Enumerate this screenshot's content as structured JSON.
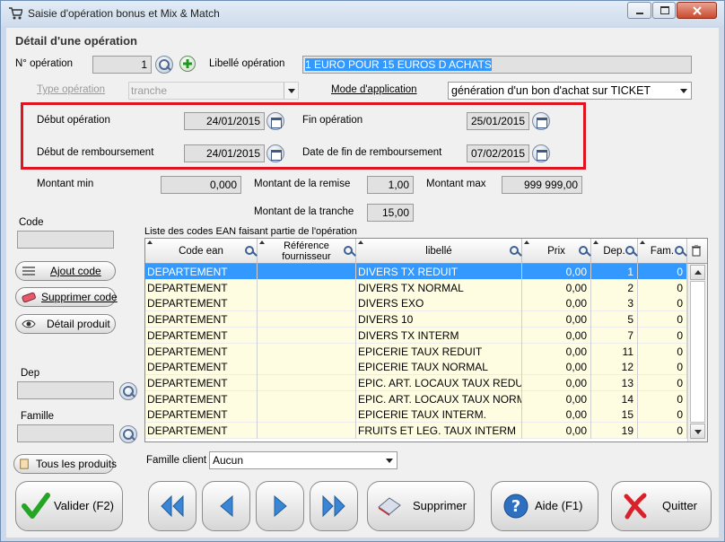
{
  "window": {
    "title": "Saisie d'opération bonus et Mix & Match"
  },
  "section_title": "Détail d'une opération",
  "operation": {
    "numero_label": "N° opération",
    "numero_value": "1",
    "libelle_label": "Libellé opération",
    "libelle_value": "1 EURO POUR 15 EUROS D ACHATS",
    "type_label": "Type opération",
    "type_value": "tranche",
    "mode_label": "Mode d'application",
    "mode_value": "génération d'un bon d'achat sur TICKET"
  },
  "dates": {
    "debut_operation_label": "Début opération",
    "debut_operation_value": "24/01/2015",
    "fin_operation_label": "Fin opération",
    "fin_operation_value": "25/01/2015",
    "debut_remboursement_label": "Début de remboursement",
    "debut_remboursement_value": "24/01/2015",
    "fin_remboursement_label": "Date de fin de remboursement",
    "fin_remboursement_value": "07/02/2015"
  },
  "amounts": {
    "min_label": "Montant min",
    "min_value": "0,000",
    "remise_label": "Montant de la remise",
    "remise_value": "1,00",
    "max_label": "Montant max",
    "max_value": "999 999,00",
    "tranche_label": "Montant de la tranche",
    "tranche_value": "15,00"
  },
  "left": {
    "code_label": "Code",
    "ajout_code": "Ajout code",
    "supprimer_code": "Supprimer code",
    "detail_produit": "Détail produit",
    "dep_label": "Dep",
    "famille_label": "Famille",
    "tous_produits": "Tous les produits"
  },
  "table": {
    "caption": "Liste des codes EAN faisant partie de l'opération",
    "headers": {
      "code_ean": "Code ean",
      "reference_1": "Référence",
      "reference_2": "fournisseur",
      "libelle": "libellé",
      "prix": "Prix",
      "dep": "Dep.",
      "fam": "Fam."
    },
    "rows": [
      {
        "code": "DEPARTEMENT",
        "ref": "",
        "libelle": "DIVERS TX REDUIT",
        "prix": "0,00",
        "dep": "1",
        "fam": "0"
      },
      {
        "code": "DEPARTEMENT",
        "ref": "",
        "libelle": "DIVERS TX NORMAL",
        "prix": "0,00",
        "dep": "2",
        "fam": "0"
      },
      {
        "code": "DEPARTEMENT",
        "ref": "",
        "libelle": "DIVERS EXO",
        "prix": "0,00",
        "dep": "3",
        "fam": "0"
      },
      {
        "code": "DEPARTEMENT",
        "ref": "",
        "libelle": "DIVERS 10",
        "prix": "0,00",
        "dep": "5",
        "fam": "0"
      },
      {
        "code": "DEPARTEMENT",
        "ref": "",
        "libelle": "DIVERS TX INTERM",
        "prix": "0,00",
        "dep": "7",
        "fam": "0"
      },
      {
        "code": "DEPARTEMENT",
        "ref": "",
        "libelle": "EPICERIE TAUX REDUIT",
        "prix": "0,00",
        "dep": "11",
        "fam": "0"
      },
      {
        "code": "DEPARTEMENT",
        "ref": "",
        "libelle": "EPICERIE TAUX NORMAL",
        "prix": "0,00",
        "dep": "12",
        "fam": "0"
      },
      {
        "code": "DEPARTEMENT",
        "ref": "",
        "libelle": "EPIC. ART. LOCAUX TAUX REDUIT",
        "prix": "0,00",
        "dep": "13",
        "fam": "0"
      },
      {
        "code": "DEPARTEMENT",
        "ref": "",
        "libelle": "EPIC. ART. LOCAUX TAUX NORMAL",
        "prix": "0,00",
        "dep": "14",
        "fam": "0"
      },
      {
        "code": "DEPARTEMENT",
        "ref": "",
        "libelle": "EPICERIE TAUX INTERM.",
        "prix": "0,00",
        "dep": "15",
        "fam": "0"
      },
      {
        "code": "DEPARTEMENT",
        "ref": "",
        "libelle": "FRUITS ET LEG. TAUX INTERM",
        "prix": "0,00",
        "dep": "19",
        "fam": "0"
      }
    ]
  },
  "famille_client": {
    "label": "Famille client",
    "value": "Aucun"
  },
  "footer": {
    "valider": "Valider (F2)",
    "supprimer": "Supprimer",
    "aide": "Aide (F1)",
    "quitter": "Quitter"
  },
  "colors": {
    "highlight": "#e0141f",
    "selection": "#3399ff",
    "row_bg": "#fffde1"
  }
}
